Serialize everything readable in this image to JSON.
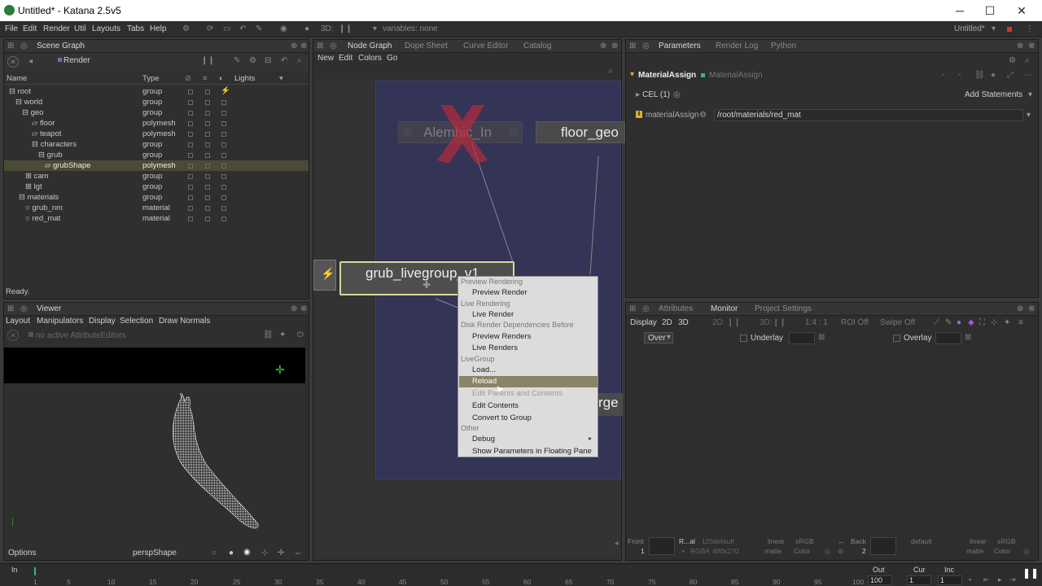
{
  "window": {
    "title": "Untitled* - Katana 2.5v5",
    "minimize": "─",
    "maximize": "☐",
    "close": "✕"
  },
  "menubar": {
    "items": [
      "File",
      "Edit",
      "Render",
      "Util",
      "Layouts",
      "Tabs",
      "Help"
    ],
    "threeD": "3D:",
    "variables": "variables: none",
    "project": "Untitled*"
  },
  "scenegraph": {
    "tab": "Scene Graph",
    "render_label": "Render",
    "columns": {
      "name": "Name",
      "type": "Type",
      "lights": "Lights"
    },
    "rows": [
      {
        "name": "root",
        "type": "group"
      },
      {
        "name": "world",
        "type": "group"
      },
      {
        "name": "geo",
        "type": "group"
      },
      {
        "name": "floor",
        "type": "polymesh"
      },
      {
        "name": "teapot",
        "type": "polymesh"
      },
      {
        "name": "characters",
        "type": "group"
      },
      {
        "name": "grub",
        "type": "group"
      },
      {
        "name": "grubShape",
        "type": "polymesh"
      },
      {
        "name": "cam",
        "type": "group"
      },
      {
        "name": "lgt",
        "type": "group"
      },
      {
        "name": "materials",
        "type": "group"
      },
      {
        "name": "grub_nm",
        "type": "material"
      },
      {
        "name": "red_mat",
        "type": "material"
      }
    ],
    "status": "Ready."
  },
  "viewer": {
    "tab": "Viewer",
    "menu": [
      "Layout",
      "Manipulators",
      "Display",
      "Selection",
      "Draw Normals"
    ],
    "no_editors": "no active AttributeEditors",
    "options": "Options",
    "camera": "perspShape"
  },
  "nodegraph": {
    "tabs": [
      "Node Graph",
      "Dope Sheet",
      "Curve Editor",
      "Catalog"
    ],
    "menu": [
      "New",
      "Edit",
      "Colors",
      "Go"
    ],
    "nodes": {
      "alembic": "Alembic_In",
      "floor": "floor_geo",
      "livegroup": "grub_livegroup_v1",
      "merge": "rge"
    }
  },
  "context_menu": {
    "h_preview": "Preview Rendering",
    "preview_render": "Preview Render",
    "h_live": "Live Rendering",
    "live_render": "Live Render",
    "h_disk": "Disk Render Dependencies Before",
    "preview_renders": "Preview Renders",
    "live_renders": "Live Renders",
    "h_livegroup": "LiveGroup",
    "load": "Load...",
    "reload": "Reload",
    "edit_parents": "Edit Parents and Contents",
    "edit_contents": "Edit Contents",
    "convert": "Convert to Group",
    "h_other": "Other",
    "debug": "Debug",
    "show_params": "Show Parameters in Floating Pane"
  },
  "parameters": {
    "tabs": [
      "Parameters",
      "Render Log",
      "Python"
    ],
    "node_name": "MaterialAssign",
    "node_type": "MaterialAssign",
    "cel": "CEL (1)",
    "add_statements": "Add Statements",
    "param_label": "materialAssign",
    "param_value": "/root/materials/red_mat"
  },
  "monitor": {
    "tabs": [
      "Attributes",
      "Monitor",
      "Project Settings"
    ],
    "display": "Display",
    "d2": "2D",
    "d3": "3D",
    "t2d": "2D:",
    "t3d": "3D:",
    "ratio": "1:4 : 1",
    "roi": "ROI Off",
    "swipe": "Swipe Off",
    "over": "Over",
    "underlay": "Underlay",
    "overlay": "Overlay",
    "front": "Front",
    "front_num": "1",
    "r_al": "R...al",
    "default125": "125default",
    "rgba": "RGBA",
    "res": "480x270",
    "linear": "linear",
    "srgb": "sRGB",
    "matte": "matte",
    "color": "Color",
    "back": "Back",
    "back_num": "2",
    "default": "default"
  },
  "timeline": {
    "in": "In",
    "out": "Out",
    "cur": "Cur",
    "inc": "Inc",
    "in_val": "1",
    "out_val": "100",
    "cur_val": "1",
    "inc_val": "1",
    "ticks": [
      "1",
      "5",
      "10",
      "15",
      "20",
      "25",
      "30",
      "35",
      "40",
      "45",
      "50",
      "55",
      "60",
      "65",
      "70",
      "75",
      "80",
      "85",
      "90",
      "95",
      "100"
    ]
  },
  "colors": {
    "accent": "#e0b030",
    "selection": "#4a4a36",
    "menu_highlight": "#8a8466"
  }
}
